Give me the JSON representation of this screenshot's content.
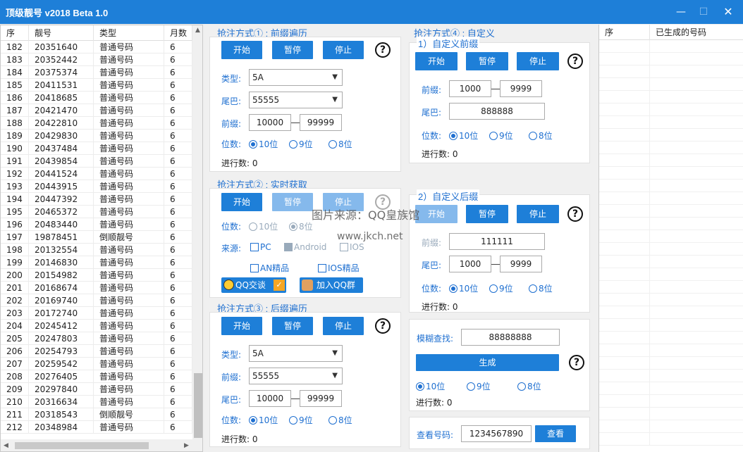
{
  "window": {
    "title": "顶级靓号 v2018 Beta 1.0"
  },
  "left_table": {
    "headers": [
      "序",
      "靓号",
      "类型",
      "月数"
    ],
    "rows": [
      [
        "182",
        "20351640",
        "普通号码",
        "6"
      ],
      [
        "183",
        "20352442",
        "普通号码",
        "6"
      ],
      [
        "184",
        "20375374",
        "普通号码",
        "6"
      ],
      [
        "185",
        "20411531",
        "普通号码",
        "6"
      ],
      [
        "186",
        "20418685",
        "普通号码",
        "6"
      ],
      [
        "187",
        "20421470",
        "普通号码",
        "6"
      ],
      [
        "188",
        "20422810",
        "普通号码",
        "6"
      ],
      [
        "189",
        "20429830",
        "普通号码",
        "6"
      ],
      [
        "190",
        "20437484",
        "普通号码",
        "6"
      ],
      [
        "191",
        "20439854",
        "普通号码",
        "6"
      ],
      [
        "192",
        "20441524",
        "普通号码",
        "6"
      ],
      [
        "193",
        "20443915",
        "普通号码",
        "6"
      ],
      [
        "194",
        "20447392",
        "普通号码",
        "6"
      ],
      [
        "195",
        "20465372",
        "普通号码",
        "6"
      ],
      [
        "196",
        "20483440",
        "普通号码",
        "6"
      ],
      [
        "197",
        "19878451",
        "倒顺靓号",
        "6"
      ],
      [
        "198",
        "20132554",
        "普通号码",
        "6"
      ],
      [
        "199",
        "20146830",
        "普通号码",
        "6"
      ],
      [
        "200",
        "20154982",
        "普通号码",
        "6"
      ],
      [
        "201",
        "20168674",
        "普通号码",
        "6"
      ],
      [
        "202",
        "20169740",
        "普通号码",
        "6"
      ],
      [
        "203",
        "20172740",
        "普通号码",
        "6"
      ],
      [
        "204",
        "20245412",
        "普通号码",
        "6"
      ],
      [
        "205",
        "20247803",
        "普通号码",
        "6"
      ],
      [
        "206",
        "20254793",
        "普通号码",
        "6"
      ],
      [
        "207",
        "20259542",
        "普通号码",
        "6"
      ],
      [
        "208",
        "20276405",
        "普通号码",
        "6"
      ],
      [
        "209",
        "20297840",
        "普通号码",
        "6"
      ],
      [
        "210",
        "20316634",
        "普通号码",
        "6"
      ],
      [
        "211",
        "20318543",
        "倒顺靓号",
        "6"
      ],
      [
        "212",
        "20348984",
        "普通号码",
        "6"
      ]
    ]
  },
  "common": {
    "start": "开始",
    "pause": "暂停",
    "stop": "停止",
    "help": "?",
    "type_label": "类型:",
    "tail_label": "尾巴:",
    "prefix_label": "前缀:",
    "digits_label": "位数:",
    "progress_label": "进行数:",
    "d10": "10位",
    "d9": "9位",
    "d8": "8位"
  },
  "m1": {
    "title": "抢注方式① : 前缀遍历",
    "type": "5A",
    "tail": "55555",
    "from": "10000",
    "to": "99999",
    "progress": "0"
  },
  "m2": {
    "title": "抢注方式② : 实时获取",
    "source_label": "来源:",
    "pc": "PC",
    "android": "Android",
    "ios": "IOS",
    "an_premium": "AN精品",
    "ios_premium": "IOS精品",
    "qq_chat": "QQ交谈",
    "join_group": "加入QQ群"
  },
  "m3": {
    "title": "抢注方式③ : 后缀遍历",
    "type": "5A",
    "prefix": "55555",
    "from": "10000",
    "to": "99999",
    "progress": "0"
  },
  "m4": {
    "title": "抢注方式④ : 自定义",
    "sub1": "1）自定义前缀",
    "p_from": "1000",
    "p_to": "9999",
    "tail": "888888",
    "progress1": "0",
    "sub2": "2）自定义后缀",
    "prefix2": "111111",
    "t_from": "1000",
    "t_to": "9999",
    "progress2": "0"
  },
  "fuzzy": {
    "label": "模糊查找:",
    "value": "88888888",
    "generate": "生成",
    "progress": "0"
  },
  "lookup": {
    "label": "查看号码:",
    "value": "1234567890",
    "button": "查看"
  },
  "right_table": {
    "headers": [
      "序",
      "已生成的号码"
    ]
  },
  "watermark": {
    "line1": "图片来源：QQ皇族馆",
    "line2": "www.jkch.net"
  }
}
